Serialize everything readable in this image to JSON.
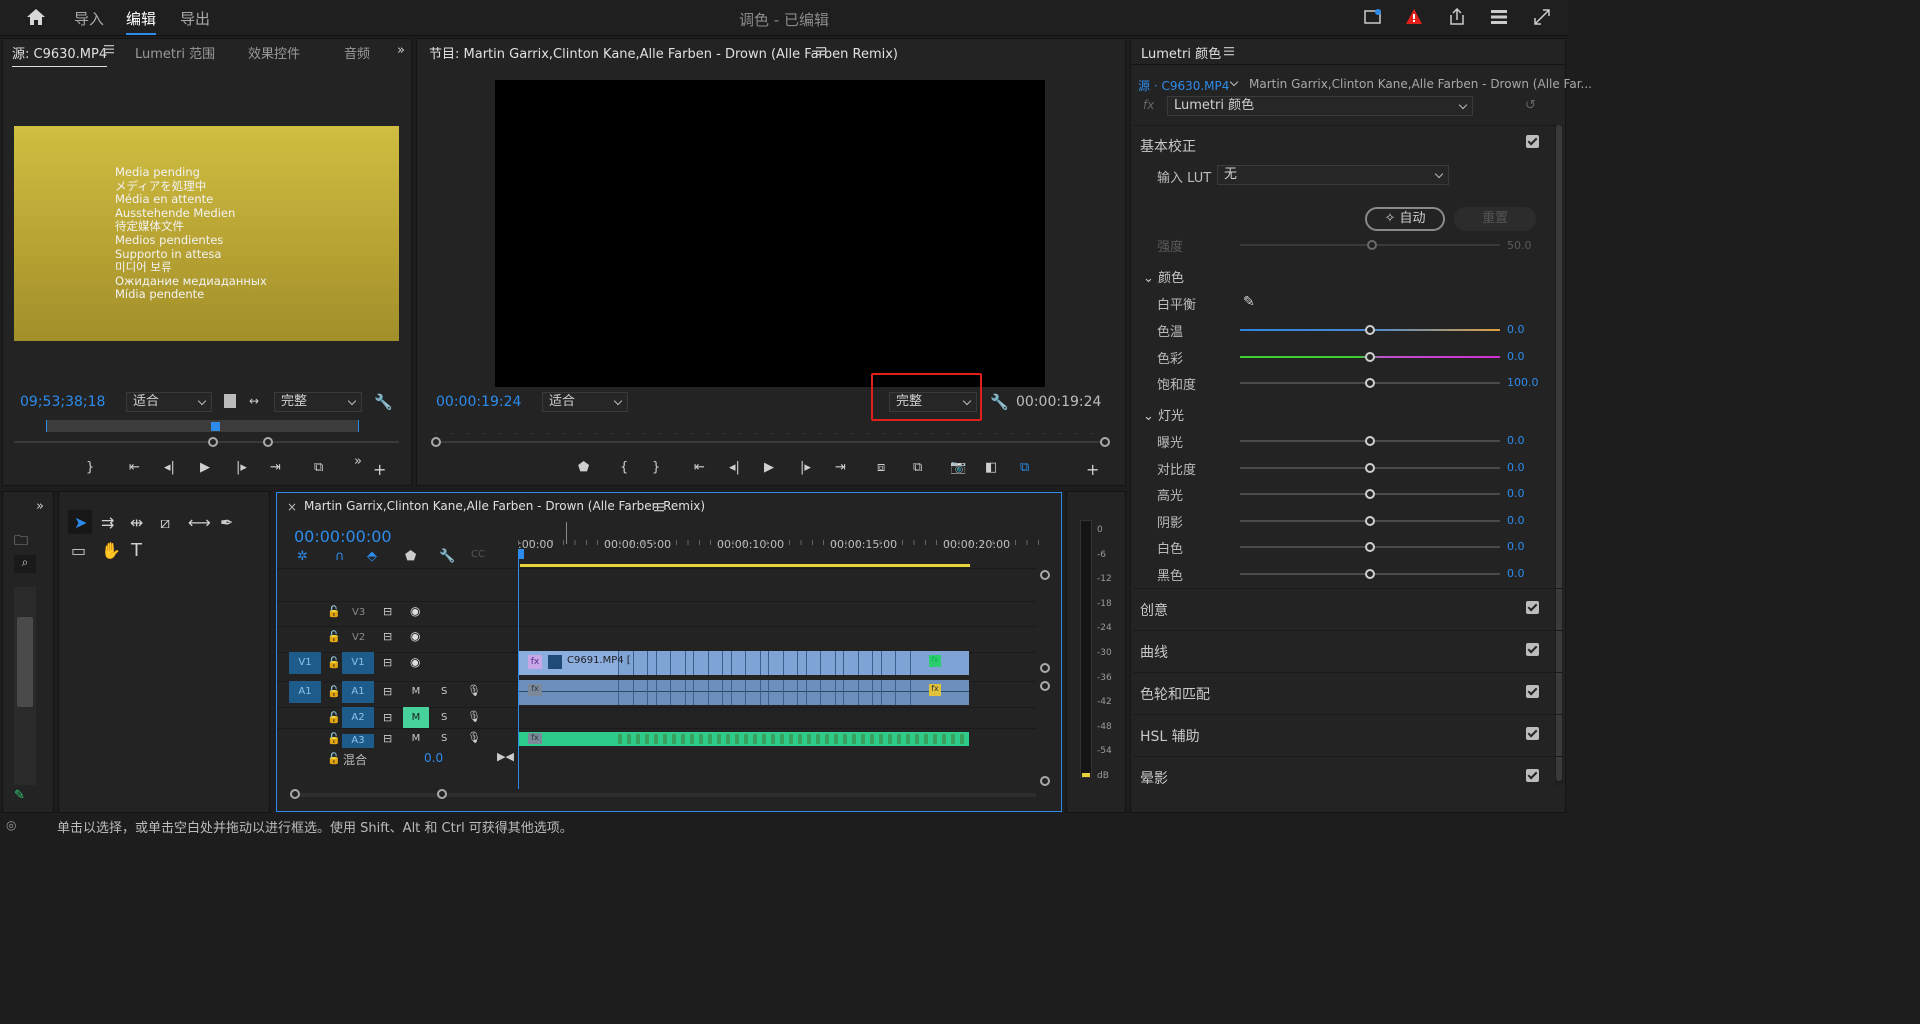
{
  "topbar": {
    "tabs": [
      "导入",
      "编辑",
      "导出"
    ],
    "active_tab": "编辑",
    "title": "调色 - 已编辑"
  },
  "source_panel": {
    "tabs": [
      "源: C9630.MP4",
      "Lumetri 范围",
      "效果控件",
      "音频"
    ],
    "media_pending_lines": [
      "Media pending",
      "メディアを処理中",
      "Média en attente",
      "Ausstehende Medien",
      "待定媒体文件",
      "Medios pendientes",
      "Supporto in attesa",
      "미디어 보류",
      "Ожидание медиаданных",
      "Mídia pendente"
    ],
    "timecode": "09;53;38;18",
    "fit": "适合",
    "quality": "完整"
  },
  "program_panel": {
    "title": "节目: Martin Garrix,Clinton Kane,Alle Farben - Drown (Alle Farben Remix)",
    "timecode_left": "00:00:19:24",
    "fit": "适合",
    "quality": "完整",
    "timecode_right": "00:00:19:24"
  },
  "lumetri": {
    "title": "Lumetri 颜色",
    "source": "源 · C9630.MP4",
    "sequence": "Martin Garrix,Clinton Kane,Alle Farben - Drown (Alle Far...",
    "effect": "Lumetri 颜色",
    "basic": "基本校正",
    "input_lut_label": "输入 LUT",
    "input_lut_value": "无",
    "auto": "自动",
    "reset": "重置",
    "intensity": {
      "label": "强度",
      "value": "50.0",
      "pos": 0.5
    },
    "color_header": "颜色",
    "white_balance": "白平衡",
    "color_sliders": [
      {
        "label": "色温",
        "value": "0.0",
        "pos": 0.5
      },
      {
        "label": "色彩",
        "value": "0.0",
        "pos": 0.5
      },
      {
        "label": "饱和度",
        "value": "100.0",
        "pos": 0.5
      }
    ],
    "light_header": "灯光",
    "light_sliders": [
      {
        "label": "曝光",
        "value": "0.0",
        "pos": 0.5
      },
      {
        "label": "对比度",
        "value": "0.0",
        "pos": 0.5
      },
      {
        "label": "高光",
        "value": "0.0",
        "pos": 0.5
      },
      {
        "label": "阴影",
        "value": "0.0",
        "pos": 0.5
      },
      {
        "label": "白色",
        "value": "0.0",
        "pos": 0.5
      },
      {
        "label": "黑色",
        "value": "0.0",
        "pos": 0.5
      }
    ],
    "sections": [
      "创意",
      "曲线",
      "色轮和匹配",
      "HSL 辅助",
      "晕影"
    ]
  },
  "timeline": {
    "title": "Martin Garrix,Clinton Kane,Alle Farben - Drown (Alle Farben Remix)",
    "timecode": "00:00:00:00",
    "ruler": [
      ":00:00",
      "00:00:05:00",
      "00:00:10:00",
      "00:00:15:00",
      "00:00:20:00"
    ],
    "tracks": [
      "V3",
      "V2",
      "V1",
      "A1",
      "A2",
      "A3"
    ],
    "clip_name": "C9691.MP4 [",
    "mix_label": "混合",
    "mix_value": "0.0"
  },
  "meter": {
    "labels": [
      "0",
      "-6",
      "-12",
      "-18",
      "-24",
      "-30",
      "-36",
      "-42",
      "-48",
      "-54",
      "dB"
    ]
  },
  "statusbar": {
    "text": "单击以选择，或单击空白处并拖动以进行框选。使用 Shift、Alt 和 Ctrl 可获得其他选项。"
  },
  "colors": {
    "accent": "#2d8ceb",
    "highlight": "#e0201a"
  }
}
